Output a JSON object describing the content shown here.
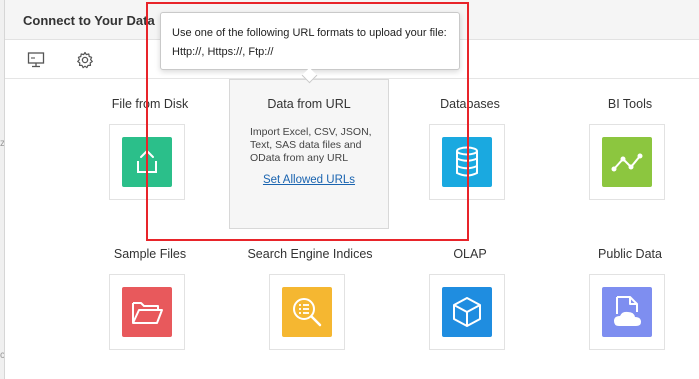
{
  "dialog": {
    "title": "Connect to Your Data"
  },
  "toolbar": {
    "monitor_icon": "monitor-icon",
    "gear_icon": "gear-icon"
  },
  "tooltip": {
    "line1": "Use one of the following URL formats to upload your file:",
    "line2": "Http://, Https://, Ftp://"
  },
  "url_card": {
    "title": "Data from URL",
    "description": "Import Excel, CSV, JSON, Text, SAS data files and OData from any URL",
    "link": "Set Allowed URLs"
  },
  "tiles": [
    {
      "label": "File from Disk",
      "icon": "upload-icon",
      "color": "#2bbf8a"
    },
    {
      "label": "Databases",
      "icon": "database-icon",
      "color": "#1aa9e0"
    },
    {
      "label": "BI Tools",
      "icon": "chart-icon",
      "color": "#8cc63f"
    },
    {
      "label": "Sample Files",
      "icon": "folder-icon",
      "color": "#e8595c"
    },
    {
      "label": "Search Engine Indices",
      "icon": "search-icon",
      "color": "#f5b731"
    },
    {
      "label": "OLAP",
      "icon": "cube-icon",
      "color": "#1f8de0"
    },
    {
      "label": "Public Data",
      "icon": "cloud-file-icon",
      "color": "#7e8ef0"
    }
  ],
  "edge": {
    "char1": "z",
    "char2": "c"
  },
  "highlight_color": "#e8242a"
}
